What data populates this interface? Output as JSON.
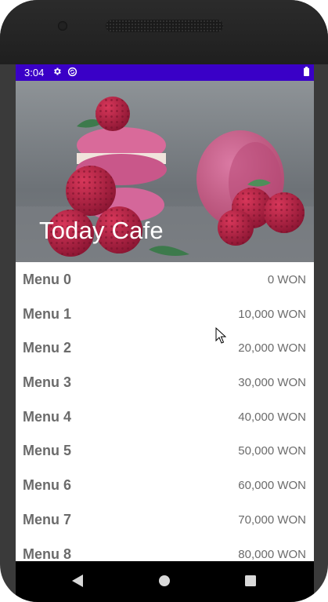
{
  "status_bar": {
    "time": "3:04",
    "icons": [
      "gear-icon",
      "sync-icon",
      "battery-icon"
    ],
    "background_color": "#3a00c7"
  },
  "hero": {
    "title": "Today Cafe",
    "image": "macarons-raspberries-photo"
  },
  "menu": {
    "items": [
      {
        "name": "Menu 0",
        "price": "0 WON"
      },
      {
        "name": "Menu 1",
        "price": "10,000 WON"
      },
      {
        "name": "Menu 2",
        "price": "20,000 WON"
      },
      {
        "name": "Menu 3",
        "price": "30,000 WON"
      },
      {
        "name": "Menu 4",
        "price": "40,000 WON"
      },
      {
        "name": "Menu 5",
        "price": "50,000 WON"
      },
      {
        "name": "Menu 6",
        "price": "60,000 WON"
      },
      {
        "name": "Menu 7",
        "price": "70,000 WON"
      },
      {
        "name": "Menu 8",
        "price": "80,000 WON"
      }
    ]
  },
  "nav_bar": {
    "icons": [
      "back-icon",
      "home-icon",
      "recents-icon"
    ]
  }
}
